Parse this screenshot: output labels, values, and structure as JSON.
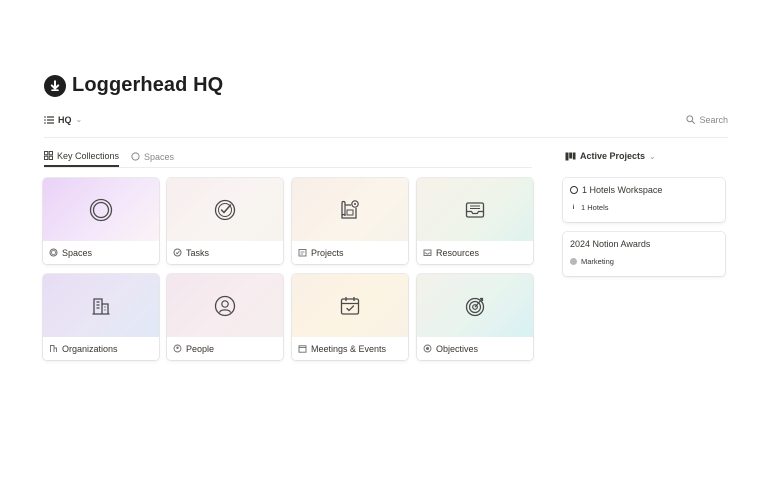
{
  "page": {
    "title": "Loggerhead HQ"
  },
  "view_bar": {
    "view_label": "HQ",
    "search_label": "Search"
  },
  "tabs": [
    {
      "label": "Key Collections",
      "icon": "grid-icon",
      "active": true
    },
    {
      "label": "Spaces",
      "icon": "circle-icon",
      "active": false
    }
  ],
  "collections": [
    {
      "label": "Spaces",
      "icon": "circle-ring-icon",
      "gradient": [
        "#ead2f7",
        "#f3e7fa",
        "#fbf3f7"
      ]
    },
    {
      "label": "Tasks",
      "icon": "check-badge-icon",
      "gradient": [
        "#f7eef0",
        "#f9f4f1",
        "#f7f3ee"
      ]
    },
    {
      "label": "Projects",
      "icon": "blueprint-icon",
      "gradient": [
        "#f8eee8",
        "#fbf4ea",
        "#f7f3ea"
      ]
    },
    {
      "label": "Resources",
      "icon": "inbox-tray-icon",
      "gradient": [
        "#f6f2e9",
        "#eef4ea",
        "#dff3ef"
      ]
    },
    {
      "label": "Organizations",
      "icon": "building-icon",
      "gradient": [
        "#e7ddf4",
        "#e9e6f5",
        "#e1e9f6"
      ]
    },
    {
      "label": "People",
      "icon": "person-circle-icon",
      "gradient": [
        "#f3e7ee",
        "#f7ecef",
        "#f5eeee"
      ]
    },
    {
      "label": "Meetings & Events",
      "icon": "calendar-check-icon",
      "gradient": [
        "#faf0e6",
        "#fcf4e3",
        "#f8f2e6"
      ]
    },
    {
      "label": "Objectives",
      "icon": "target-icon",
      "gradient": [
        "#f3f1ea",
        "#e8f4ee",
        "#d8f1f4"
      ]
    }
  ],
  "side": {
    "header": "Active Projects",
    "projects": [
      {
        "title": "1 Hotels Workspace",
        "tag": "1 Hotels",
        "tag_icon": "info-icon",
        "has_status_ring": true
      },
      {
        "title": "2024 Notion Awards",
        "tag": "Marketing",
        "tag_icon": "gray-dot-icon",
        "has_status_ring": false
      }
    ]
  },
  "colors": {
    "text": "#37352f",
    "muted": "#8a8884",
    "divider": "#ececea",
    "icon_stroke": "#4a4a4a"
  }
}
